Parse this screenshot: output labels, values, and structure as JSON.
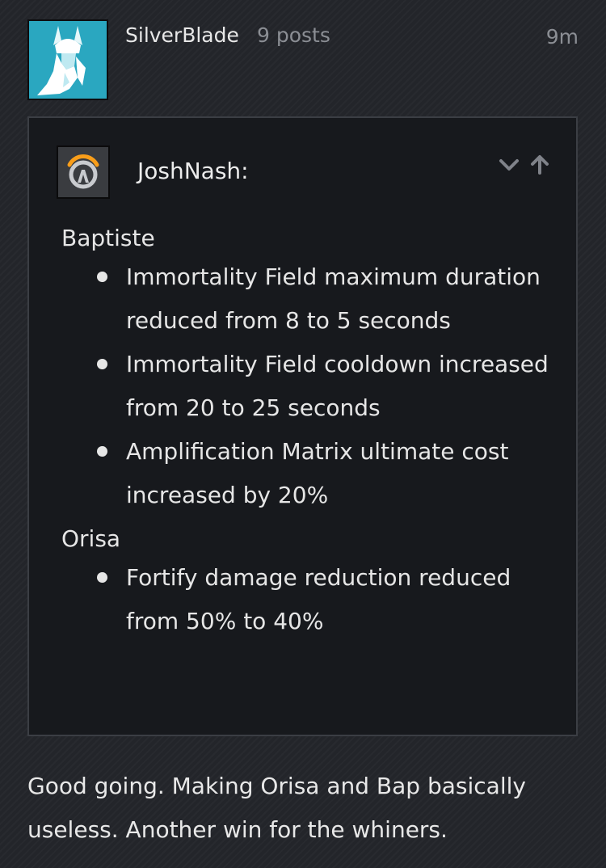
{
  "post": {
    "username": "SilverBlade",
    "post_count": "9 posts",
    "timestamp": "9m",
    "avatar_icon": "white-winged-helmet-hero-icon",
    "avatar_bg": "#2aa7c0",
    "reply_text": "Good going. Making Orisa and Bap basically useless. Another win for the whiners."
  },
  "quote": {
    "author": "JoshNash:",
    "avatar_icon": "overwatch-logo-icon",
    "expand_icon": "chevron-down-icon",
    "goto_icon": "arrow-up-icon",
    "sections": [
      {
        "hero": "Baptiste",
        "changes": [
          "Immortality Field maximum duration reduced from 8 to 5 seconds",
          "Immortality Field cooldown increased from 20 to 25 seconds",
          "Amplification Matrix ultimate cost increased by 20%"
        ]
      },
      {
        "hero": "Orisa",
        "changes": [
          "Fortify damage reduction reduced from 50% to 40%"
        ]
      }
    ]
  },
  "colors": {
    "background": "#23252a",
    "quote_background": "#17191d",
    "muted_text": "#8b8e94",
    "overwatch_orange": "#f99e1a"
  }
}
